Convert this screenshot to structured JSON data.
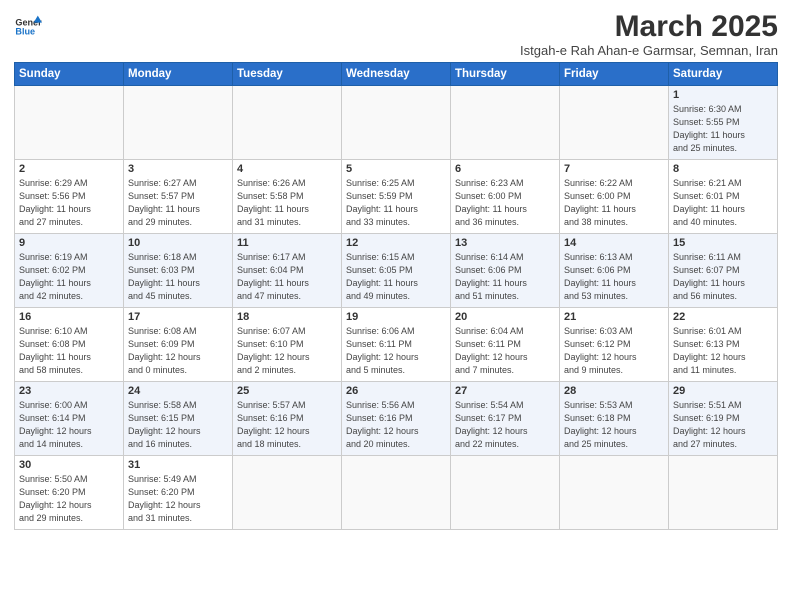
{
  "logo": {
    "line1": "General",
    "line2": "Blue"
  },
  "title": "March 2025",
  "subtitle": "Istgah-e Rah Ahan-e Garmsar, Semnan, Iran",
  "days_of_week": [
    "Sunday",
    "Monday",
    "Tuesday",
    "Wednesday",
    "Thursday",
    "Friday",
    "Saturday"
  ],
  "weeks": [
    [
      {
        "day": "",
        "info": ""
      },
      {
        "day": "",
        "info": ""
      },
      {
        "day": "",
        "info": ""
      },
      {
        "day": "",
        "info": ""
      },
      {
        "day": "",
        "info": ""
      },
      {
        "day": "",
        "info": ""
      },
      {
        "day": "1",
        "info": "Sunrise: 6:30 AM\nSunset: 5:55 PM\nDaylight: 11 hours\nand 25 minutes."
      }
    ],
    [
      {
        "day": "2",
        "info": "Sunrise: 6:29 AM\nSunset: 5:56 PM\nDaylight: 11 hours\nand 27 minutes."
      },
      {
        "day": "3",
        "info": "Sunrise: 6:27 AM\nSunset: 5:57 PM\nDaylight: 11 hours\nand 29 minutes."
      },
      {
        "day": "4",
        "info": "Sunrise: 6:26 AM\nSunset: 5:58 PM\nDaylight: 11 hours\nand 31 minutes."
      },
      {
        "day": "5",
        "info": "Sunrise: 6:25 AM\nSunset: 5:59 PM\nDaylight: 11 hours\nand 33 minutes."
      },
      {
        "day": "6",
        "info": "Sunrise: 6:23 AM\nSunset: 6:00 PM\nDaylight: 11 hours\nand 36 minutes."
      },
      {
        "day": "7",
        "info": "Sunrise: 6:22 AM\nSunset: 6:00 PM\nDaylight: 11 hours\nand 38 minutes."
      },
      {
        "day": "8",
        "info": "Sunrise: 6:21 AM\nSunset: 6:01 PM\nDaylight: 11 hours\nand 40 minutes."
      }
    ],
    [
      {
        "day": "9",
        "info": "Sunrise: 6:19 AM\nSunset: 6:02 PM\nDaylight: 11 hours\nand 42 minutes."
      },
      {
        "day": "10",
        "info": "Sunrise: 6:18 AM\nSunset: 6:03 PM\nDaylight: 11 hours\nand 45 minutes."
      },
      {
        "day": "11",
        "info": "Sunrise: 6:17 AM\nSunset: 6:04 PM\nDaylight: 11 hours\nand 47 minutes."
      },
      {
        "day": "12",
        "info": "Sunrise: 6:15 AM\nSunset: 6:05 PM\nDaylight: 11 hours\nand 49 minutes."
      },
      {
        "day": "13",
        "info": "Sunrise: 6:14 AM\nSunset: 6:06 PM\nDaylight: 11 hours\nand 51 minutes."
      },
      {
        "day": "14",
        "info": "Sunrise: 6:13 AM\nSunset: 6:06 PM\nDaylight: 11 hours\nand 53 minutes."
      },
      {
        "day": "15",
        "info": "Sunrise: 6:11 AM\nSunset: 6:07 PM\nDaylight: 11 hours\nand 56 minutes."
      }
    ],
    [
      {
        "day": "16",
        "info": "Sunrise: 6:10 AM\nSunset: 6:08 PM\nDaylight: 11 hours\nand 58 minutes."
      },
      {
        "day": "17",
        "info": "Sunrise: 6:08 AM\nSunset: 6:09 PM\nDaylight: 12 hours\nand 0 minutes."
      },
      {
        "day": "18",
        "info": "Sunrise: 6:07 AM\nSunset: 6:10 PM\nDaylight: 12 hours\nand 2 minutes."
      },
      {
        "day": "19",
        "info": "Sunrise: 6:06 AM\nSunset: 6:11 PM\nDaylight: 12 hours\nand 5 minutes."
      },
      {
        "day": "20",
        "info": "Sunrise: 6:04 AM\nSunset: 6:11 PM\nDaylight: 12 hours\nand 7 minutes."
      },
      {
        "day": "21",
        "info": "Sunrise: 6:03 AM\nSunset: 6:12 PM\nDaylight: 12 hours\nand 9 minutes."
      },
      {
        "day": "22",
        "info": "Sunrise: 6:01 AM\nSunset: 6:13 PM\nDaylight: 12 hours\nand 11 minutes."
      }
    ],
    [
      {
        "day": "23",
        "info": "Sunrise: 6:00 AM\nSunset: 6:14 PM\nDaylight: 12 hours\nand 14 minutes."
      },
      {
        "day": "24",
        "info": "Sunrise: 5:58 AM\nSunset: 6:15 PM\nDaylight: 12 hours\nand 16 minutes."
      },
      {
        "day": "25",
        "info": "Sunrise: 5:57 AM\nSunset: 6:16 PM\nDaylight: 12 hours\nand 18 minutes."
      },
      {
        "day": "26",
        "info": "Sunrise: 5:56 AM\nSunset: 6:16 PM\nDaylight: 12 hours\nand 20 minutes."
      },
      {
        "day": "27",
        "info": "Sunrise: 5:54 AM\nSunset: 6:17 PM\nDaylight: 12 hours\nand 22 minutes."
      },
      {
        "day": "28",
        "info": "Sunrise: 5:53 AM\nSunset: 6:18 PM\nDaylight: 12 hours\nand 25 minutes."
      },
      {
        "day": "29",
        "info": "Sunrise: 5:51 AM\nSunset: 6:19 PM\nDaylight: 12 hours\nand 27 minutes."
      }
    ],
    [
      {
        "day": "30",
        "info": "Sunrise: 5:50 AM\nSunset: 6:20 PM\nDaylight: 12 hours\nand 29 minutes."
      },
      {
        "day": "31",
        "info": "Sunrise: 5:49 AM\nSunset: 6:20 PM\nDaylight: 12 hours\nand 31 minutes."
      },
      {
        "day": "",
        "info": ""
      },
      {
        "day": "",
        "info": ""
      },
      {
        "day": "",
        "info": ""
      },
      {
        "day": "",
        "info": ""
      },
      {
        "day": "",
        "info": ""
      }
    ]
  ]
}
